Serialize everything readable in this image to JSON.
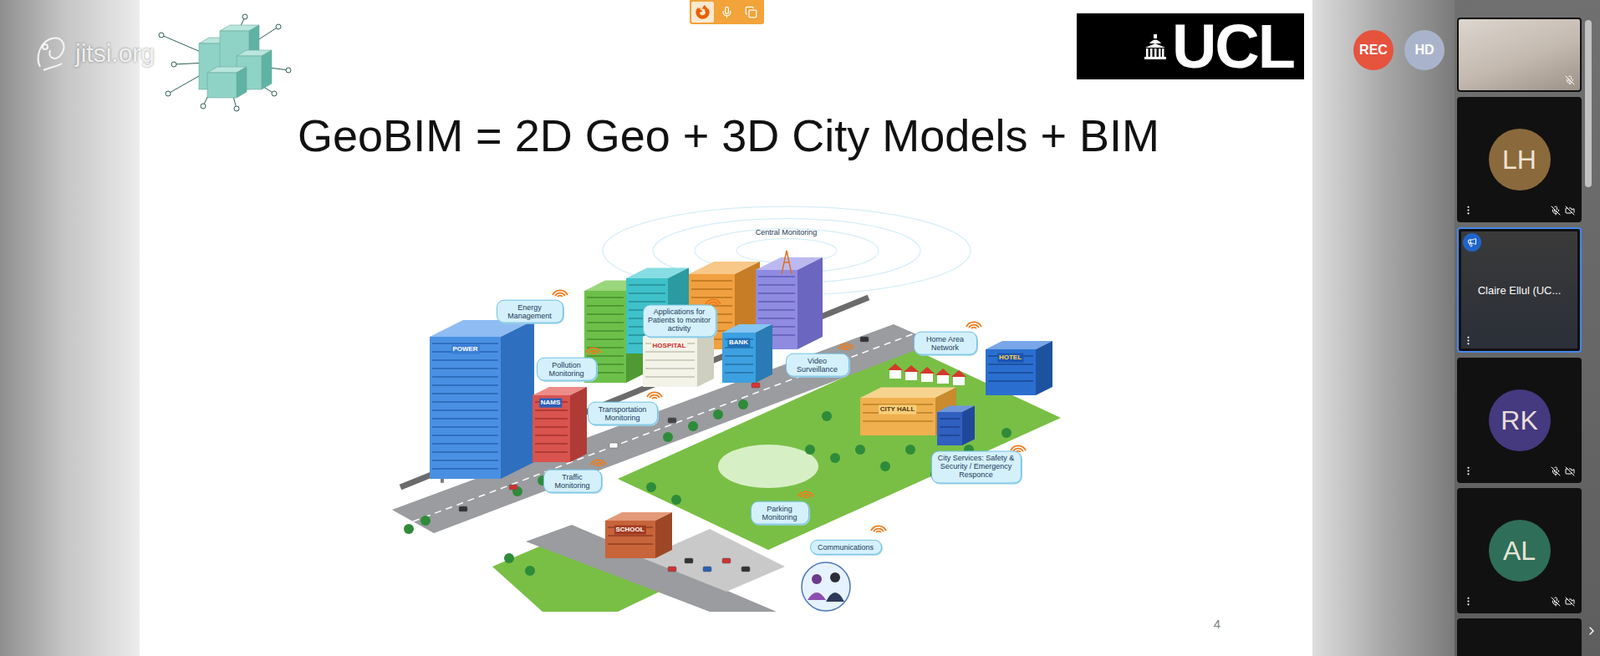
{
  "watermark": {
    "text": "jitsi.org"
  },
  "badges": [
    {
      "label": "REC",
      "color": "#e5533d"
    },
    {
      "label": "HD",
      "color": "#a9b4cc"
    }
  ],
  "slide": {
    "title": "GeoBIM = 2D Geo + 3D City Models + BIM",
    "logo": "UCL",
    "page_number": "4",
    "illustration": {
      "labels": [
        {
          "text": "Central Monitoring",
          "kind": "plain"
        },
        {
          "text": "Energy Management",
          "kind": "bubble"
        },
        {
          "text": "Applications for Patients to monitor activity",
          "kind": "bubble"
        },
        {
          "text": "Pollution Monitoring",
          "kind": "bubble"
        },
        {
          "text": "Video Surveillance",
          "kind": "bubble"
        },
        {
          "text": "Home Area Network",
          "kind": "bubble"
        },
        {
          "text": "Transportation Monitoring",
          "kind": "bubble"
        },
        {
          "text": "Traffic Monitoring",
          "kind": "bubble"
        },
        {
          "text": "City Services: Safety & Security / Emergency Responce",
          "kind": "bubble"
        },
        {
          "text": "Parking Monitoring",
          "kind": "bubble"
        },
        {
          "text": "Communications",
          "kind": "bubble"
        }
      ],
      "signs": [
        "POWER",
        "HOSPITAL",
        "BANK",
        "NAMS",
        "CITY HALL",
        "HOTEL",
        "SCHOOL"
      ]
    }
  },
  "participants": [
    {
      "kind": "local-video",
      "muted": true,
      "selected": false
    },
    {
      "kind": "avatar",
      "initials": "LH",
      "color": "#8a6a3c",
      "muted": true,
      "video_off": true,
      "selected": false
    },
    {
      "kind": "screen-share",
      "name": "Claire Ellul (UC...",
      "dominant_speaker": true,
      "selected": true
    },
    {
      "kind": "avatar",
      "initials": "RK",
      "color": "#45397f",
      "muted": true,
      "video_off": true,
      "selected": false
    },
    {
      "kind": "avatar",
      "initials": "AL",
      "color": "#2f6e58",
      "muted": true,
      "video_off": true,
      "selected": false
    },
    {
      "kind": "cut-off",
      "selected": false
    }
  ]
}
